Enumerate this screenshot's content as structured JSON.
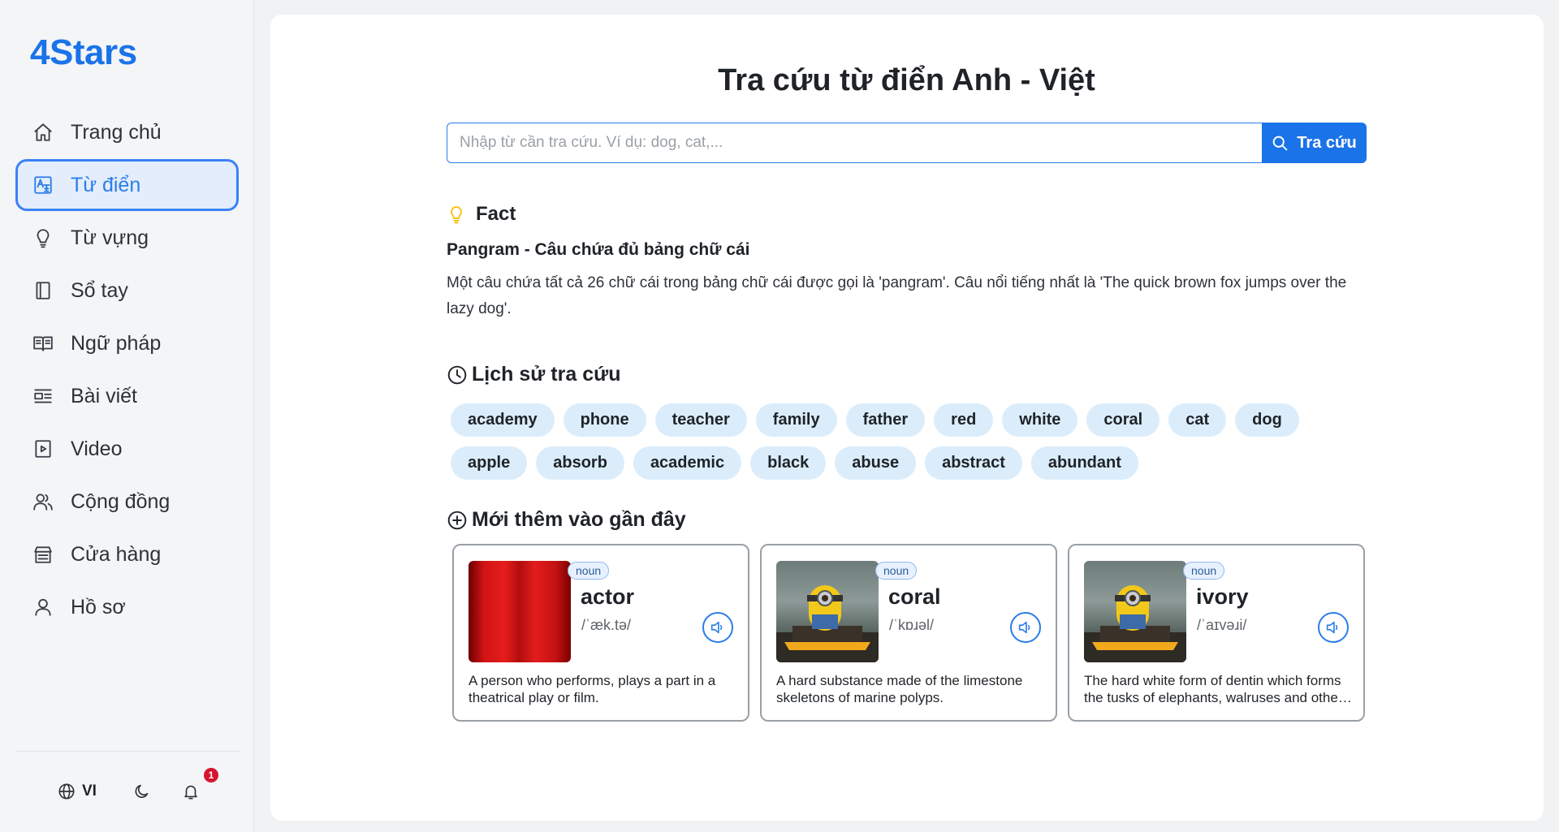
{
  "app": {
    "logo": "4Stars",
    "accent": "#1a73e8"
  },
  "sidebar": {
    "items": [
      {
        "label": "Trang chủ",
        "icon": "home-icon",
        "active": false
      },
      {
        "label": "Từ điển",
        "icon": "dictionary-icon",
        "active": true
      },
      {
        "label": "Từ vựng",
        "icon": "lightbulb-icon",
        "active": false
      },
      {
        "label": "Sổ tay",
        "icon": "notebook-icon",
        "active": false
      },
      {
        "label": "Ngữ pháp",
        "icon": "book-open-icon",
        "active": false
      },
      {
        "label": "Bài viết",
        "icon": "article-icon",
        "active": false
      },
      {
        "label": "Video",
        "icon": "video-icon",
        "active": false
      },
      {
        "label": "Cộng đồng",
        "icon": "community-icon",
        "active": false
      },
      {
        "label": "Cửa hàng",
        "icon": "store-icon",
        "active": false
      },
      {
        "label": "Hồ sơ",
        "icon": "user-icon",
        "active": false
      }
    ],
    "footer": {
      "language": "VI",
      "notification_count": "1"
    }
  },
  "main": {
    "title": "Tra cứu từ điển Anh - Việt",
    "search": {
      "placeholder": "Nhập từ cần tra cứu. Ví dụ: dog, cat,...",
      "button_label": "Tra cứu"
    },
    "fact": {
      "heading": "Fact",
      "title": "Pangram - Câu chứa đủ bảng chữ cái",
      "body": "Một câu chứa tất cả 26 chữ cái trong bảng chữ cái được gọi là 'pangram'. Câu nổi tiếng nhất là 'The quick brown fox jumps over the lazy dog'."
    },
    "history": {
      "heading": "Lịch sử tra cứu",
      "tags": [
        "academy",
        "phone",
        "teacher",
        "family",
        "father",
        "red",
        "white",
        "coral",
        "cat",
        "dog",
        "apple",
        "absorb",
        "academic",
        "black",
        "abuse",
        "abstract",
        "abundant"
      ]
    },
    "recent": {
      "heading": "Mới thêm vào gần đây",
      "cards": [
        {
          "pos": "noun",
          "word": "actor",
          "ipa": "/ˈæk.tə/",
          "definition": "A person who performs, plays a part in a theatrical play or film."
        },
        {
          "pos": "noun",
          "word": "coral",
          "ipa": "/ˈkɒɹəl/",
          "definition": "A hard substance made of the limestone skeletons of marine polyps."
        },
        {
          "pos": "noun",
          "word": "ivory",
          "ipa": "/ˈaɪvəɹi/",
          "definition": "The hard white form of dentin which forms the tusks of elephants, walruses and other animals."
        }
      ]
    }
  }
}
